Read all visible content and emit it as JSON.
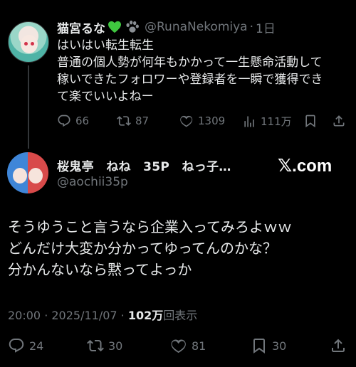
{
  "parent_tweet": {
    "display_name": "猫宮るな",
    "handle": "@RunaNekomiya",
    "separator": "·",
    "time": "1日",
    "text_lines": [
      "はいはい転生転生",
      "普通の個人勢が何年もかかって一生懸命活動して",
      "稼いできたフォロワーや登録者を一瞬で獲得でき",
      "て楽でいいよねー"
    ],
    "actions": {
      "replies": "66",
      "reposts": "87",
      "likes": "1309",
      "views": "111万"
    },
    "badges": [
      "green-heart-icon",
      "paw-print-icon"
    ],
    "colors": {
      "green_heart": "#3fc63f",
      "paw": "#8a8f94"
    }
  },
  "main_tweet": {
    "display_name": "桜鬼亭　ねね　35P　ねっ子…",
    "handle": "@aochii35p",
    "text_lines": [
      "そうゆうこと言うなら企業入ってみろよｗｗ",
      "どんだけ大変か分かってゆってんのかな？",
      "分かんないなら黙ってよっか"
    ],
    "meta": {
      "time": "20:00",
      "separator1": " · ",
      "date": "2025/11/07",
      "separator2": " · ",
      "views_count": "102万",
      "views_label": "回表示"
    },
    "actions": {
      "replies": "24",
      "reposts": "30",
      "likes": "81",
      "bookmarks": "30"
    }
  },
  "watermark": {
    "mark": "𝕏",
    "text": ".com"
  },
  "colors": {
    "background": "#000000",
    "text": "#e7e9ea",
    "muted": "#71767b",
    "thread_line": "#333639"
  }
}
